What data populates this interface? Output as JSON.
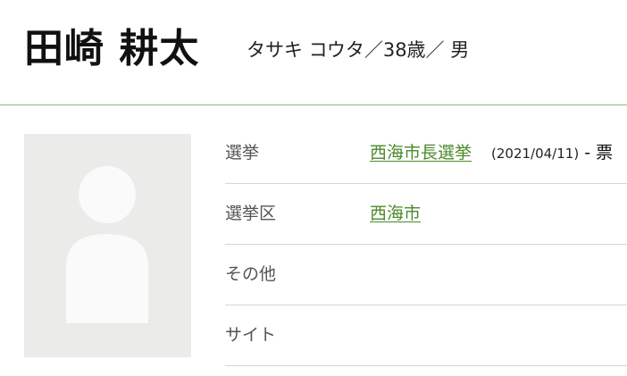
{
  "profile": {
    "name": "田崎 耕太",
    "meta": "タサキ コウタ／38歳／ 男"
  },
  "colors": {
    "accent_green": "#4a8a2a",
    "divider_green": "#8dc26a",
    "avatar_bg": "#ebebe9"
  },
  "avatar": {
    "icon": "person-placeholder-icon"
  },
  "rows": [
    {
      "label": "選挙",
      "link": "西海市長選挙",
      "date": "(2021/04/11)",
      "votes": "- 票"
    },
    {
      "label": "選挙区",
      "link": "西海市"
    },
    {
      "label": "その他"
    },
    {
      "label": "サイト"
    }
  ]
}
